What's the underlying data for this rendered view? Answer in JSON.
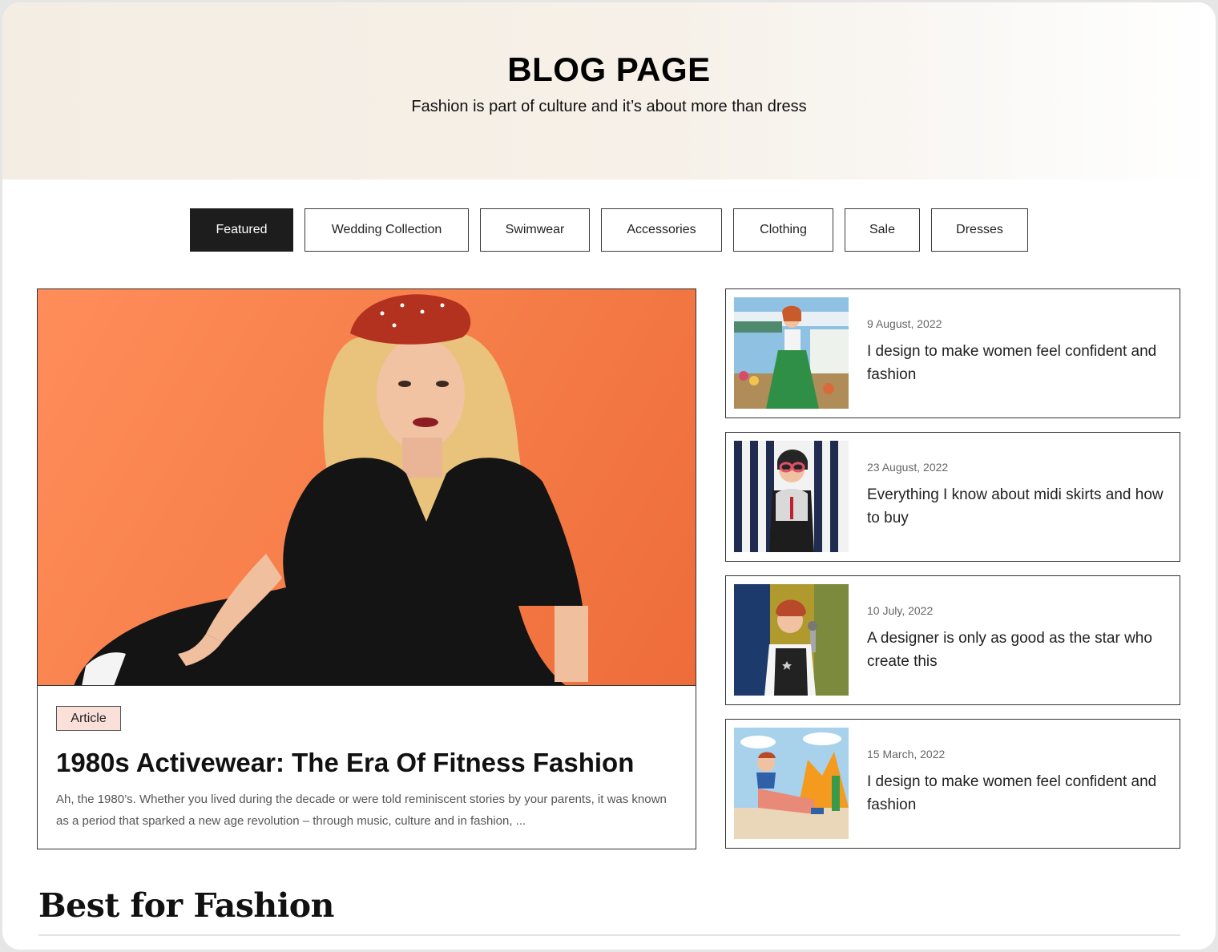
{
  "header": {
    "title": "BLOG PAGE",
    "subtitle": "Fashion is part of culture and it’s about more than dress"
  },
  "filters": [
    {
      "label": "Featured",
      "active": true
    },
    {
      "label": "Wedding Collection",
      "active": false
    },
    {
      "label": "Swimwear",
      "active": false
    },
    {
      "label": "Accessories",
      "active": false
    },
    {
      "label": "Clothing",
      "active": false
    },
    {
      "label": "Sale",
      "active": false
    },
    {
      "label": "Dresses",
      "active": false
    }
  ],
  "featured": {
    "badge": "Article",
    "title": "1980s Activewear: The Era Of Fitness Fashion",
    "excerpt": "Ah, the 1980’s. Whether you lived during the decade or were told reminiscent stories by your parents, it was known as a period that sparked a new age revolution – through music, culture and in fashion, ..."
  },
  "posts": [
    {
      "date": "9 August, 2022",
      "title": "I design to make women feel confident and fashion"
    },
    {
      "date": "23 August, 2022",
      "title": "Everything I know about midi skirts and how to buy"
    },
    {
      "date": "10 July, 2022",
      "title": "A designer is only as good as the star who create this"
    },
    {
      "date": "15 March, 2022",
      "title": "I design to make women feel confident and fashion"
    }
  ],
  "section": {
    "title": "Best for Fashion"
  },
  "colors": {
    "accent_dark": "#1d1d1d",
    "badge_bg": "#fbe0da",
    "featured_backdrop": "#f57d48"
  }
}
